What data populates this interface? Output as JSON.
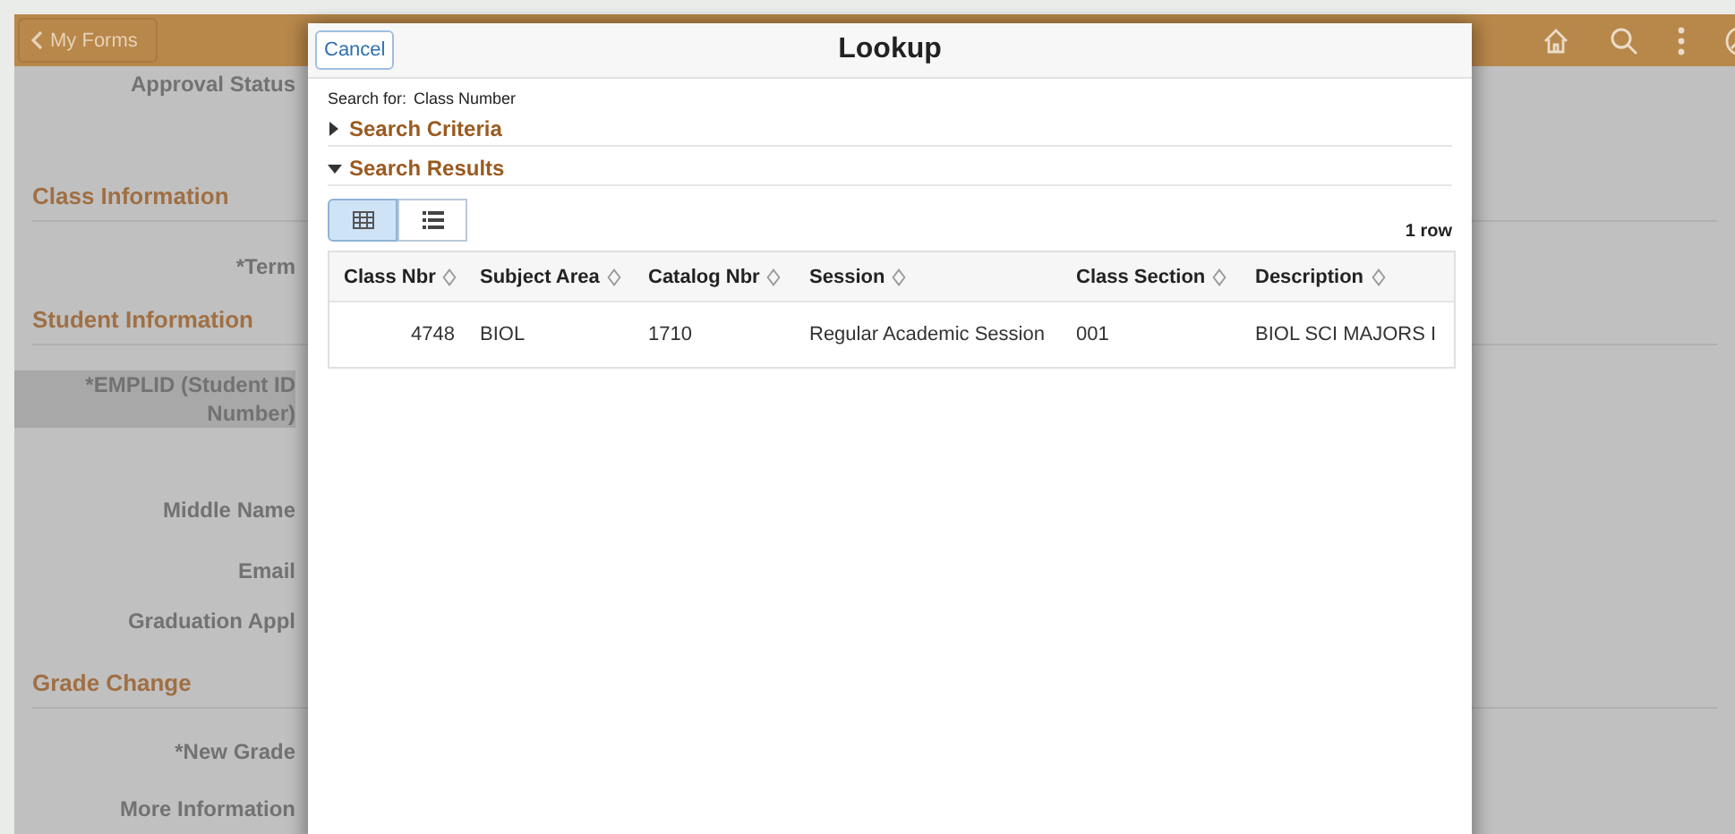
{
  "header": {
    "back_button": "My Forms"
  },
  "form": [
    {
      "kind": "field",
      "label": "Approval Status",
      "highlighted": false
    },
    {
      "kind": "section",
      "label": "Class Information"
    },
    {
      "kind": "field",
      "label": "*Term",
      "highlighted": false
    },
    {
      "kind": "section",
      "label": "Student Information"
    },
    {
      "kind": "field",
      "label": "*EMPLID (Student ID Number)",
      "highlighted": true
    },
    {
      "kind": "field",
      "label": "Middle Name",
      "highlighted": false
    },
    {
      "kind": "field",
      "label": "Email",
      "highlighted": false
    },
    {
      "kind": "field",
      "label": "Graduation Appl",
      "highlighted": false
    },
    {
      "kind": "section",
      "label": "Grade Change"
    },
    {
      "kind": "field",
      "label": "*New Grade",
      "highlighted": false
    },
    {
      "kind": "field",
      "label": "More Information",
      "highlighted": false
    }
  ],
  "modal": {
    "title": "Lookup",
    "cancel_button": "Cancel",
    "search_for_label": "Search for:",
    "search_for_value": "Class Number",
    "sections": [
      {
        "label": "Search Criteria",
        "expanded": false
      },
      {
        "label": "Search Results",
        "expanded": true
      }
    ],
    "view_toggle": [
      {
        "kind": "grid",
        "selected": true
      },
      {
        "kind": "list",
        "selected": false
      }
    ],
    "row_count": "1 row",
    "table": {
      "columns": [
        "Class Nbr",
        "Subject Area",
        "Catalog Nbr",
        "Session",
        "Class Section",
        "Description"
      ],
      "rows": [
        [
          "4748",
          "BIOL",
          "1710",
          "Regular Academic Session",
          "001",
          "BIOL SCI MAJORS I"
        ]
      ]
    }
  }
}
